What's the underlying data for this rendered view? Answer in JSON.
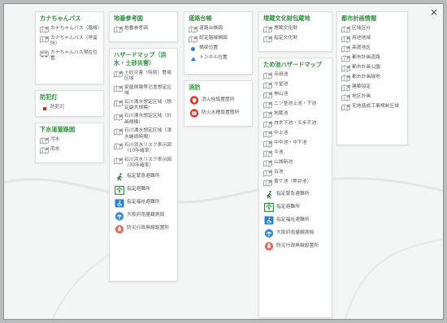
{
  "close_label": "×",
  "colors": {
    "accent": "#2e8f3c",
    "marker_red": "#d42a1e",
    "marker_blue": "#2f7fd3"
  },
  "panels": {
    "kanachan": {
      "title": "カナちゃんバス",
      "items": [
        {
          "label": "カナちゃんバス（路線）",
          "icon": "map-layer-icon"
        },
        {
          "label": "カナちゃんバス（停留所）",
          "icon": "map-layer-icon"
        },
        {
          "label": "カナちゃんバス現在位置",
          "icon": "bus-icon"
        }
      ]
    },
    "bohanto": {
      "title": "防犯灯",
      "items": [
        {
          "label": "防犯灯",
          "icon": "red-square-icon"
        }
      ]
    },
    "gesui": {
      "title": "下水道管路図",
      "items": [
        {
          "label": "汚水",
          "icon": "map-layer-icon"
        },
        {
          "label": "雨水",
          "icon": "map-layer-icon"
        }
      ]
    },
    "chiban": {
      "title": "地番参考図",
      "items": [
        {
          "label": "地番参考図",
          "icon": "map-layer-icon"
        }
      ]
    },
    "hazard": {
      "title": "ハザードマップ（洪水・土砂災害）",
      "items": [
        {
          "label": "土砂災害（特別）警戒区域",
          "icon": "map-layer-icon"
        },
        {
          "label": "家屋倒壊等氾濫想定区域",
          "icon": "map-layer-icon"
        },
        {
          "label": "石川湯水想定区域（想定最大規模）",
          "icon": "map-layer-icon"
        },
        {
          "label": "石川湯水想定区域（計画規模）",
          "icon": "map-layer-icon"
        },
        {
          "label": "石川湯水想定区域（浸水継続時間）",
          "icon": "map-layer-icon"
        },
        {
          "label": "石川洪水リスク表示図（10年確率）",
          "icon": "map-layer-icon"
        },
        {
          "label": "石川洪水リスク表示図（30年確率）",
          "icon": "map-layer-icon"
        },
        {
          "label": "指定緊急避難所",
          "icon": "evacuation-person-icon"
        },
        {
          "label": "指定避難所",
          "icon": "shelter-icon"
        },
        {
          "label": "指定福祉避難所",
          "icon": "welfare-shelter-icon"
        },
        {
          "label": "大阪府雨量観測局",
          "icon": "umbrella-icon"
        },
        {
          "label": "防災行政無線設置所",
          "icon": "radio-icon"
        }
      ]
    },
    "doro": {
      "title": "道路台帳",
      "items": [
        {
          "label": "道路台帳図",
          "icon": "map-layer-icon"
        },
        {
          "label": "認定路線網図",
          "icon": "map-layer-icon"
        },
        {
          "label": "橋梁位置",
          "icon": "blue-dot-icon"
        },
        {
          "label": "トンネル位置",
          "icon": "blue-triangle-icon"
        }
      ]
    },
    "shobo": {
      "title": "消防",
      "items": [
        {
          "label": "消火栓設置箇所",
          "icon": "hydrant-icon"
        },
        {
          "label": "防火水槽設置箇所",
          "icon": "water-tank-icon"
        }
      ]
    },
    "maizo": {
      "title": "埋蔵文化財包蔵地",
      "items": [
        {
          "label": "埋蔵文化財",
          "icon": "map-layer-icon"
        },
        {
          "label": "指定文化財",
          "icon": "map-layer-icon"
        }
      ]
    },
    "tameike": {
      "title": "ため池ハザードマップ",
      "items": [
        {
          "label": "寺田池",
          "icon": "map-layer-icon"
        },
        {
          "label": "今堂池",
          "icon": "map-layer-icon"
        },
        {
          "label": "神山池",
          "icon": "map-layer-icon"
        },
        {
          "label": "二ツ釜池上池・下池",
          "icon": "map-layer-icon"
        },
        {
          "label": "地蔵池",
          "icon": "map-layer-icon"
        },
        {
          "label": "白木下池・五歩芒池",
          "icon": "map-layer-icon"
        },
        {
          "label": "中上池",
          "icon": "map-layer-icon"
        },
        {
          "label": "中中池・中下池",
          "icon": "map-layer-icon"
        },
        {
          "label": "今池",
          "icon": "map-layer-icon"
        },
        {
          "label": "山城新池",
          "icon": "map-layer-icon"
        },
        {
          "label": "古池",
          "icon": "map-layer-icon"
        },
        {
          "label": "黄ケ池（熊井池）",
          "icon": "map-layer-icon"
        },
        {
          "label": "指定緊急避難所",
          "icon": "evacuation-person-icon"
        },
        {
          "label": "指定避難所",
          "icon": "shelter-icon"
        },
        {
          "label": "指定福祉避難所",
          "icon": "welfare-shelter-icon"
        },
        {
          "label": "大阪府雨量観測局",
          "icon": "umbrella-icon"
        },
        {
          "label": "防災行政無線設置所",
          "icon": "radio-icon"
        }
      ]
    },
    "toshi": {
      "title": "都市計画情報",
      "items": [
        {
          "label": "区域区分",
          "icon": "map-layer-icon"
        },
        {
          "label": "用途地域",
          "icon": "map-layer-icon"
        },
        {
          "label": "高度地区",
          "icon": "map-layer-icon"
        },
        {
          "label": "都市計画道路",
          "icon": "map-layer-icon"
        },
        {
          "label": "都市計画公園",
          "icon": "map-layer-icon"
        },
        {
          "label": "都市計画緑地",
          "icon": "map-layer-icon"
        },
        {
          "label": "建築協定",
          "icon": "map-layer-icon"
        },
        {
          "label": "地区計画",
          "icon": "map-layer-icon"
        },
        {
          "label": "宅地造成工事規制区域",
          "icon": "map-layer-icon"
        }
      ]
    }
  }
}
